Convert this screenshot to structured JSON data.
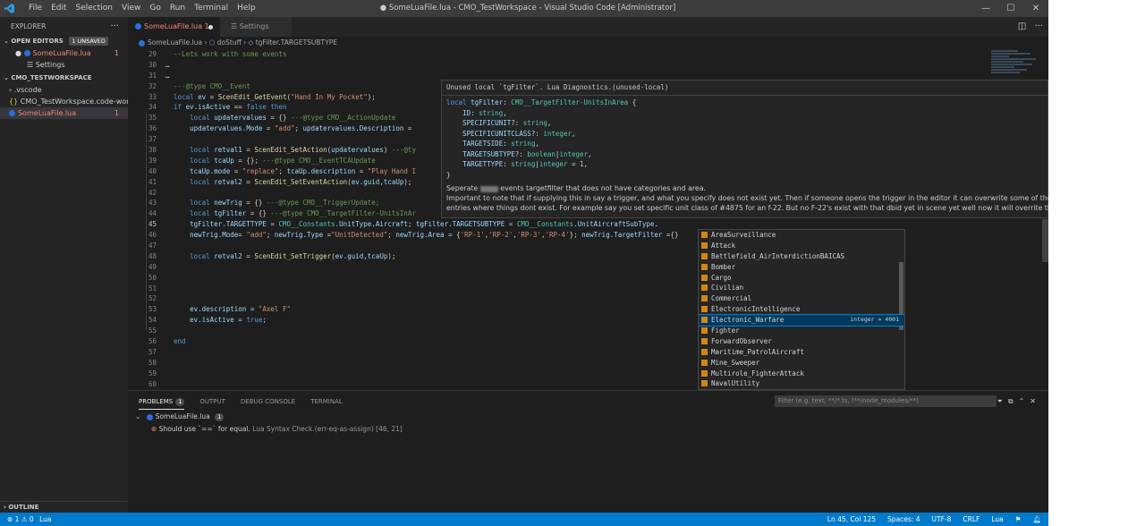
{
  "titlebar": {
    "menu": [
      "File",
      "Edit",
      "Selection",
      "View",
      "Go",
      "Run",
      "Terminal",
      "Help"
    ],
    "title": "● SomeLuaFile.lua - CMO_TestWorkspace - Visual Studio Code [Administrator]",
    "controls": [
      "—",
      "☐",
      "✕"
    ]
  },
  "sidebar": {
    "header": "EXPLORER",
    "open_editors": "OPEN EDITORS",
    "unsaved_badge": "1 UNSAVED",
    "open_files": [
      {
        "name": "SomeLuaFile.lua",
        "count": "1"
      },
      {
        "name": "Settings",
        "count": ""
      }
    ],
    "workspace": "CMO_TESTWORKSPACE",
    "tree": [
      {
        "name": ".vscode",
        "count": ""
      },
      {
        "name": "CMO_TestWorkspace.code-wor...",
        "count": ""
      },
      {
        "name": "SomeLuaFile.lua",
        "count": "1"
      }
    ],
    "outline": "OUTLINE"
  },
  "tabs": [
    {
      "label": "SomeLuaFile.lua 1"
    },
    {
      "label": "Settings"
    }
  ],
  "breadcrumb": [
    "SomeLuaFile.lua",
    "doStuff",
    "tgFilter.TARGETSUBTYPE"
  ],
  "editor": {
    "line_numbers": [
      "29",
      "30",
      "31",
      "32",
      "33",
      "34",
      "35",
      "36",
      "37",
      "38",
      "39",
      "40",
      "41",
      "42",
      "43",
      "44",
      "45",
      "46",
      "47",
      "48",
      "49",
      "50",
      "51",
      "52",
      "53",
      "54",
      "55",
      "56",
      "57",
      "58",
      "59",
      "60"
    ],
    "current_line": "45"
  },
  "hover": {
    "header": "Unused local `tgFilter`. Lua Diagnostics.(unused-local)",
    "doc": [
      "Seperate ",
      " events targetfilter that does not have categories and area.",
      "Important to note that if supplying this in say a trigger, and what you specify does not exist yet. Then if someone opens the trigger in the editor it can overwrite some of the",
      "entries where things dont exist. For example say you set specific unit class of #4875 for an f-22. But no F-22's exist with that dbid yet in scene yet well now it will overrite that"
    ]
  },
  "suggest": {
    "items": [
      "AreaSurveillance",
      "Attack",
      "Battlefield_AirInterdictionBAICAS",
      "Bomber",
      "Cargo",
      "Civilian",
      "Commercial",
      "ElectronicIntelligence",
      "Electronic_Warfare",
      "Fighter",
      "ForwardObserver",
      "Maritime_PatrolAircraft",
      "Mine_Sweeper",
      "Multirole_FighterAttack",
      "NavalUtility"
    ],
    "selected_detail": "integer = 4001"
  },
  "panel": {
    "tabs": [
      "PROBLEMS",
      "OUTPUT",
      "DEBUG CONSOLE",
      "TERMINAL"
    ],
    "problems_count": "1",
    "filter_placeholder": "Filter (e.g. text, **/*.ts, !**/node_modules/**)",
    "file": "SomeLuaFile.lua",
    "file_count": "1",
    "message": "Should use `==` for equal.",
    "source": "Lua Syntax Check.(err-eq-as-assign)",
    "position": "[46, 21]"
  },
  "statusbar": {
    "left": "⊗ 1 ⚠ 0",
    "lang_left": "Lua",
    "position": "Ln 45, Col 125",
    "spaces": "Spaces: 4",
    "encoding": "UTF-8",
    "eol": "CRLF",
    "language": "Lua"
  }
}
